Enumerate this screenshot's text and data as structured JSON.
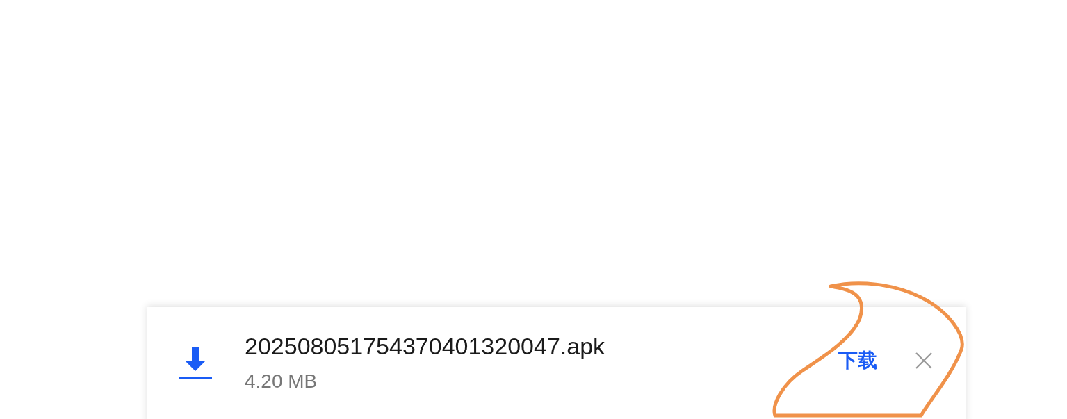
{
  "download_bar": {
    "file_name": "202508051754370401320047.apk",
    "file_size": "4.20 MB",
    "download_button": "下载"
  }
}
